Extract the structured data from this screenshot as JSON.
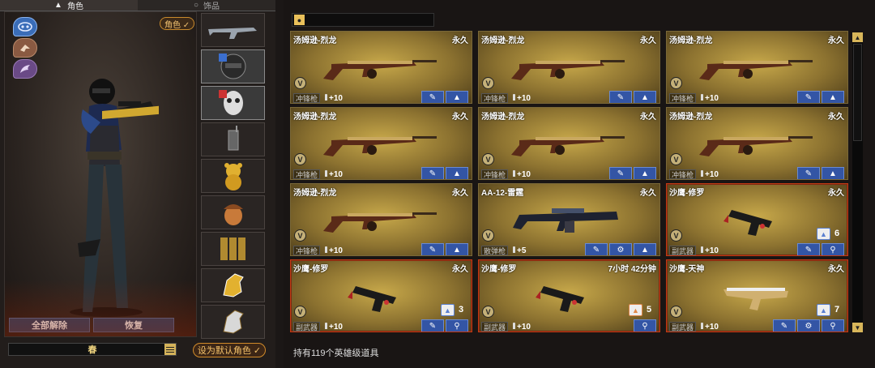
{
  "left_panel": {
    "tabs": [
      {
        "label": "角色",
        "icon": "person-icon"
      },
      {
        "label": "饰品",
        "icon": "ring-icon"
      }
    ],
    "role_badge": "角色 ✓",
    "categories": [
      "mask-category-icon",
      "bird-category-icon",
      "wing-category-icon"
    ],
    "buttons": {
      "unequip_all": "全部解除",
      "restore": "恢复"
    },
    "name_value": "春",
    "set_default": "设为默认角色 ✓",
    "slots": [
      {
        "name": "rifle-slot",
        "icon": "rifle-icon"
      },
      {
        "name": "helmet-slot",
        "icon": "helmet-icon"
      },
      {
        "name": "skull-mask-slot",
        "icon": "skull-mask-icon"
      },
      {
        "name": "radio-slot",
        "icon": "radio-icon"
      },
      {
        "name": "golden-bear-slot",
        "icon": "golden-bear-icon"
      },
      {
        "name": "acorn-slot",
        "icon": "acorn-icon"
      },
      {
        "name": "ammo-box-slot",
        "icon": "ammo-box-icon"
      },
      {
        "name": "golden-horse-slot",
        "icon": "golden-horse-icon"
      },
      {
        "name": "silver-horse-slot",
        "icon": "silver-horse-icon"
      }
    ]
  },
  "search": {
    "placeholder": ""
  },
  "items": [
    {
      "name": "汤姆逊-烈龙",
      "duration": "永久",
      "type": "冲锋枪",
      "stat": "+10",
      "gun": "tommy",
      "actions": [
        "wrench-icon",
        "up-arrow-icon"
      ],
      "red": false
    },
    {
      "name": "汤姆逊-烈龙",
      "duration": "永久",
      "type": "冲锋枪",
      "stat": "+10",
      "gun": "tommy",
      "actions": [
        "wrench-icon",
        "up-arrow-icon"
      ],
      "red": false
    },
    {
      "name": "汤姆逊-烈龙",
      "duration": "永久",
      "type": "冲锋枪",
      "stat": "+10",
      "gun": "tommy",
      "actions": [
        "wrench-icon",
        "up-arrow-icon"
      ],
      "red": false
    },
    {
      "name": "汤姆逊-烈龙",
      "duration": "永久",
      "type": "冲锋枪",
      "stat": "+10",
      "gun": "tommy",
      "actions": [
        "wrench-icon",
        "up-arrow-icon"
      ],
      "red": false
    },
    {
      "name": "汤姆逊-烈龙",
      "duration": "永久",
      "type": "冲锋枪",
      "stat": "+10",
      "gun": "tommy",
      "actions": [
        "wrench-icon",
        "up-arrow-icon"
      ],
      "red": false
    },
    {
      "name": "汤姆逊-烈龙",
      "duration": "永久",
      "type": "冲锋枪",
      "stat": "+10",
      "gun": "tommy",
      "actions": [
        "wrench-icon",
        "up-arrow-icon"
      ],
      "red": false
    },
    {
      "name": "汤姆逊-烈龙",
      "duration": "永久",
      "type": "冲锋枪",
      "stat": "+10",
      "gun": "tommy",
      "actions": [
        "wrench-icon",
        "up-arrow-icon"
      ],
      "red": false
    },
    {
      "name": "AA-12-雷霆",
      "duration": "永久",
      "type": "散弹枪",
      "stat": "+5",
      "gun": "shotgun",
      "actions": [
        "wrench-icon",
        "gear-icon",
        "up-arrow-icon"
      ],
      "red": false
    },
    {
      "name": "沙鹰-修罗",
      "duration": "永久",
      "type": "副武器",
      "stat": "+10",
      "gun": "pistol",
      "actions": [
        "wrench-icon",
        "search-icon"
      ],
      "red": true,
      "pack": {
        "count": "6",
        "color": "#5a7fd0",
        "icon": "blue-pack-icon"
      }
    },
    {
      "name": "沙鹰-修罗",
      "duration": "永久",
      "type": "副武器",
      "stat": "+10",
      "gun": "pistol",
      "actions": [
        "wrench-icon",
        "search-icon"
      ],
      "red": true,
      "pack": {
        "count": "3",
        "color": "#5a7fd0",
        "icon": "blue-pack-icon"
      }
    },
    {
      "name": "沙鹰-修罗",
      "duration": "7小时 42分钟",
      "type": "副武器",
      "stat": "+10",
      "gun": "pistol",
      "actions": [
        "search-icon"
      ],
      "red": true,
      "pack": {
        "count": "5",
        "color": "#e08848",
        "icon": "orange-pack-icon"
      }
    },
    {
      "name": "沙鹰-天神",
      "duration": "永久",
      "type": "副武器",
      "stat": "+10",
      "gun": "gold-pistol",
      "actions": [
        "wrench-icon",
        "gear-icon",
        "search-icon"
      ],
      "red": true,
      "pack": {
        "count": "7",
        "color": "#5a7fd0",
        "icon": "blue-pack-icon"
      }
    }
  ],
  "footer": "持有119个英雄级道具",
  "colors": {
    "gold": "#d8b65a",
    "action_blue": "#3355a5",
    "red_border": "#c23a14"
  }
}
